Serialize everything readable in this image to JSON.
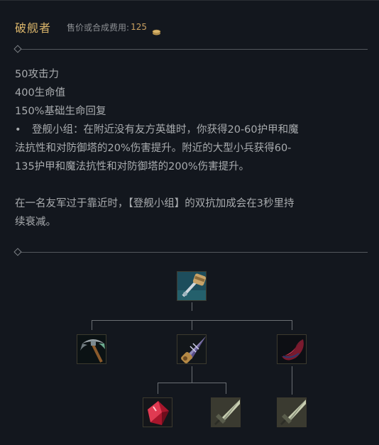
{
  "item": {
    "name": "破舰者",
    "price_label": "售价或合成费用:",
    "price_value": "125",
    "price_icon": "gold-coin-icon",
    "accent_color": "#d9b46a"
  },
  "stats": [
    "50攻击力",
    "400生命值",
    "150%基础生命回复"
  ],
  "passive": {
    "bullet": "•",
    "line1": "登舰小组：在附近没有友方英雄时，你获得20-60护甲和魔",
    "line2": "法抗性和对防御塔的20%伤害提升。附近的大型小兵获得60-",
    "line3": "135护甲和魔法抗性和对防御塔的200%伤害提升。"
  },
  "extra": {
    "line1": "在一名友军过于靠近时，【登舰小组】的双抗加成会在3秒里持",
    "line2": "续衰减。"
  },
  "recipe_tree": {
    "root": {
      "icon": "hammer-sword-item-icon"
    },
    "children": [
      {
        "icon": "pickaxe-item-icon"
      },
      {
        "icon": "drill-item-icon"
      },
      {
        "icon": "ruby-crystal-item-icon"
      }
    ],
    "grandchildren": [
      {
        "icon": "ruby-crystal-item-icon"
      },
      {
        "icon": "long-sword-item-icon"
      },
      {
        "icon": "long-sword-item-icon"
      }
    ]
  }
}
